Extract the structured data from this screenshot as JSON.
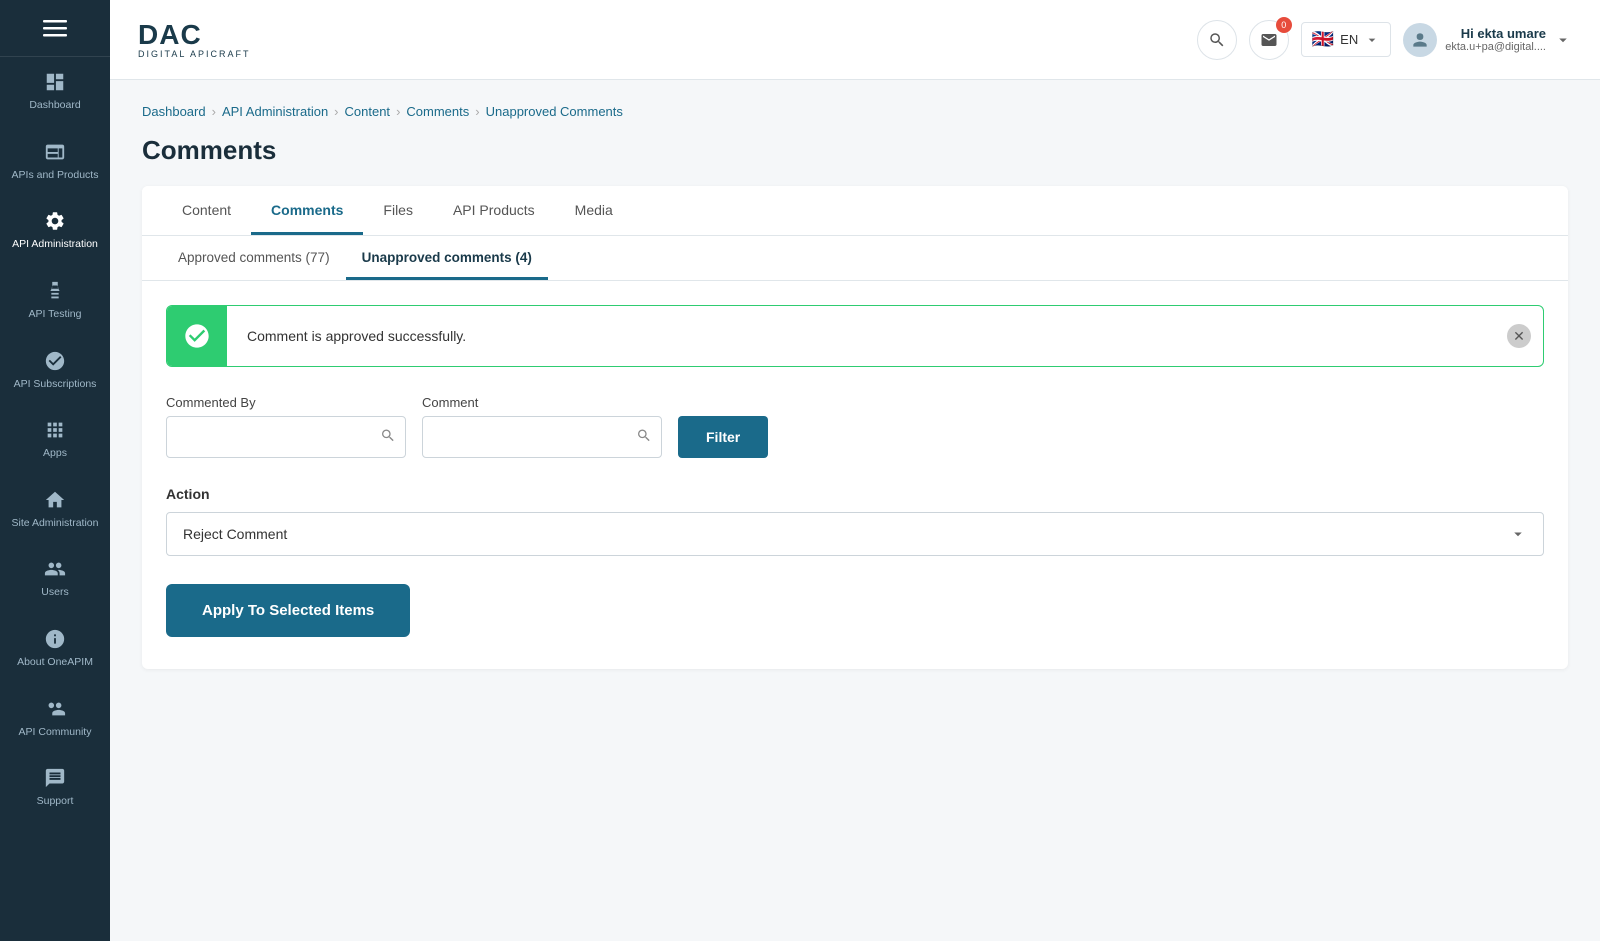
{
  "sidebar": {
    "menu_icon": "☰",
    "items": [
      {
        "id": "dashboard",
        "label": "Dashboard",
        "icon": "dashboard"
      },
      {
        "id": "apis-products",
        "label": "APIs and Products",
        "icon": "apis"
      },
      {
        "id": "api-administration",
        "label": "API Administration",
        "icon": "admin"
      },
      {
        "id": "api-testing",
        "label": "API Testing",
        "icon": "testing"
      },
      {
        "id": "api-subscriptions",
        "label": "API Subscriptions",
        "icon": "subscriptions"
      },
      {
        "id": "apps",
        "label": "Apps",
        "icon": "apps"
      },
      {
        "id": "site-administration",
        "label": "Site Administration",
        "icon": "site-admin"
      },
      {
        "id": "users",
        "label": "Users",
        "icon": "users"
      },
      {
        "id": "about-oneapim",
        "label": "About OneAPIM",
        "icon": "about"
      },
      {
        "id": "api-community",
        "label": "API Community",
        "icon": "community"
      },
      {
        "id": "support",
        "label": "Support",
        "icon": "support"
      }
    ]
  },
  "header": {
    "logo_main": "DAC",
    "logo_sub": "DIGITAL APICRAFT",
    "notification_count": "0",
    "lang": "EN",
    "user_greeting": "Hi ekta umare",
    "user_email": "ekta.u+pa@digital...."
  },
  "breadcrumb": {
    "items": [
      "Dashboard",
      "API Administration",
      "Content",
      "Comments",
      "Unapproved Comments"
    ]
  },
  "page_title": "Comments",
  "tabs": [
    {
      "id": "content",
      "label": "Content",
      "active": false
    },
    {
      "id": "comments",
      "label": "Comments",
      "active": true
    },
    {
      "id": "files",
      "label": "Files",
      "active": false
    },
    {
      "id": "api-products",
      "label": "API Products",
      "active": false
    },
    {
      "id": "media",
      "label": "Media",
      "active": false
    }
  ],
  "subtabs": [
    {
      "id": "approved",
      "label": "Approved comments (77)",
      "active": false
    },
    {
      "id": "unapproved",
      "label": "Unapproved comments (4)",
      "active": true
    }
  ],
  "alert": {
    "message": "Comment is approved successfully."
  },
  "filters": {
    "commented_by_label": "Commented By",
    "commented_by_placeholder": "",
    "comment_label": "Comment",
    "comment_placeholder": "",
    "filter_btn": "Filter"
  },
  "action": {
    "label": "Action",
    "dropdown_value": "Reject Comment"
  },
  "apply_btn": "Apply To Selected Items"
}
